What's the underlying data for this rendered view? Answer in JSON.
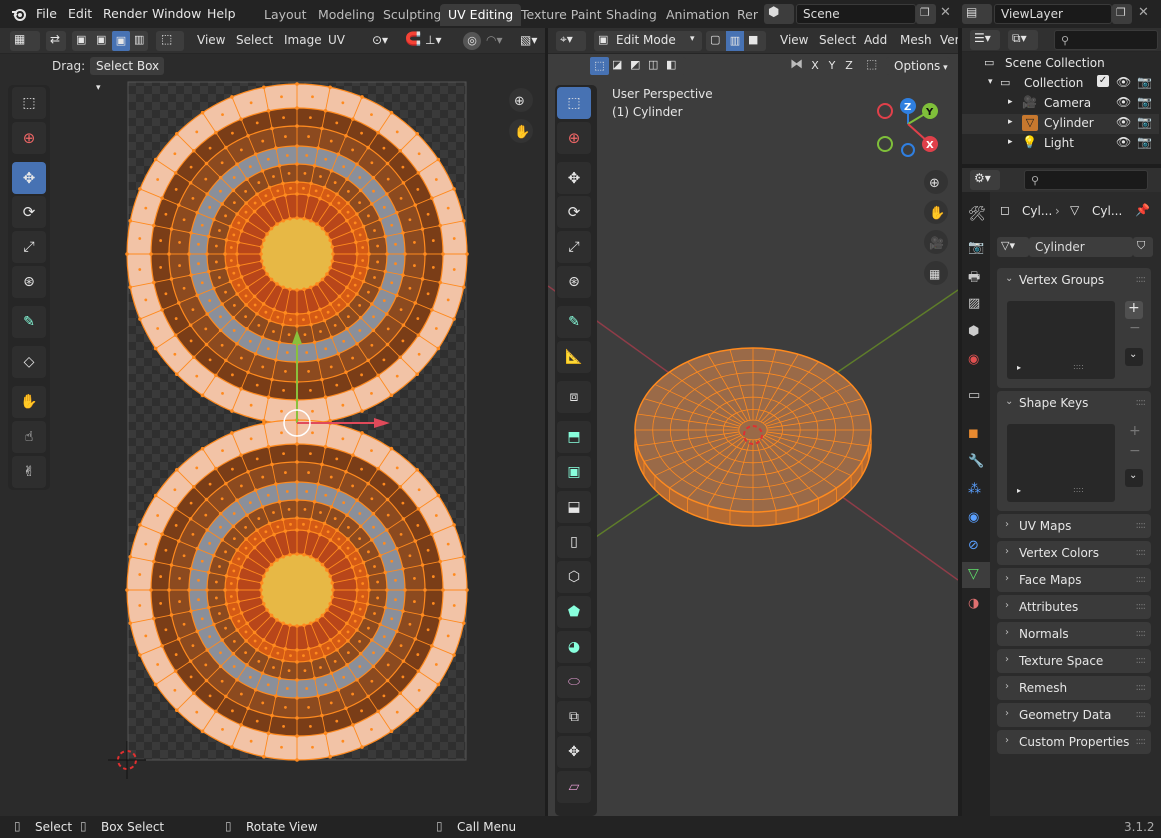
{
  "topbar": {
    "menus": [
      "File",
      "Edit",
      "Render",
      "Window",
      "Help"
    ],
    "workspaces": [
      "Layout",
      "Modeling",
      "Sculpting",
      "UV Editing",
      "Texture Paint",
      "Shading",
      "Animation",
      "Rer"
    ],
    "active_workspace": "UV Editing",
    "scene": "Scene",
    "view_layer": "ViewLayer"
  },
  "uv_editor": {
    "header_menus": [
      "View",
      "Select",
      "Image",
      "UV"
    ],
    "drag_label": "Drag:",
    "drag_value": "Select Box"
  },
  "viewport": {
    "mode": "Edit Mode",
    "header_menus": [
      "View",
      "Select",
      "Add",
      "Mesh",
      "Ver"
    ],
    "axis_locks": [
      "X",
      "Y",
      "Z"
    ],
    "options_label": "Options",
    "overlay_title": "User Perspective",
    "overlay_object": "(1) Cylinder",
    "gizmo_axes": [
      "Z",
      "Y",
      "X"
    ]
  },
  "outliner": {
    "root": "Scene Collection",
    "collection": "Collection",
    "items": [
      "Camera",
      "Cylinder",
      "Light"
    ]
  },
  "properties": {
    "breadcrumb_object": "Cyl...",
    "breadcrumb_mesh": "Cyl...",
    "mesh_name": "Cylinder",
    "panels_expanded": [
      "Vertex Groups",
      "Shape Keys"
    ],
    "panels_collapsed": [
      "UV Maps",
      "Vertex Colors",
      "Face Maps",
      "Attributes",
      "Normals",
      "Texture Space",
      "Remesh",
      "Geometry Data",
      "Custom Properties"
    ]
  },
  "statusbar": {
    "select": "Select",
    "box_select": "Box Select",
    "rotate_view": "Rotate View",
    "call_menu": "Call Menu",
    "version": "3.1.2"
  },
  "colors": {
    "accent": "#4772b3",
    "selection_orange": "#ff8a1e",
    "background": "#1d1d1d"
  }
}
